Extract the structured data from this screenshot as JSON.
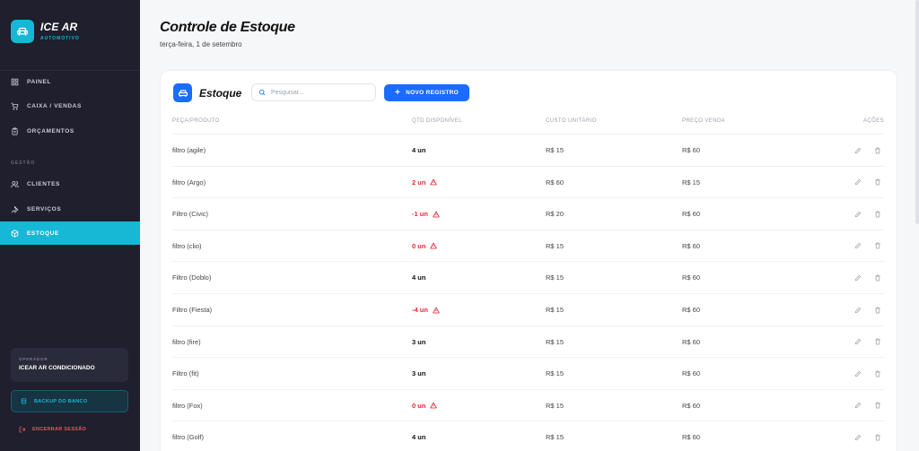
{
  "brand": {
    "name": "ICE AR",
    "subtitle": "AUTOMOTIVO"
  },
  "sidebar": {
    "items": [
      {
        "label": "PAINEL",
        "icon": "dashboard-icon"
      },
      {
        "label": "CAIXA / VENDAS",
        "icon": "cart-icon"
      },
      {
        "label": "ORÇAMENTOS",
        "icon": "clipboard-icon"
      }
    ],
    "section_label": "GESTÃO",
    "section_items": [
      {
        "label": "CLIENTES",
        "icon": "users-icon"
      },
      {
        "label": "SERVIÇOS",
        "icon": "wrench-icon"
      },
      {
        "label": "ESTOQUE",
        "icon": "box-icon",
        "active": true
      }
    ],
    "operator_label": "OPERADOR",
    "operator_name": "ICEAR AR CONDICIONADO",
    "backup_label": "BACKUP DO BANCO",
    "logout_label": "ENCERRAR SESSÃO"
  },
  "page": {
    "title": "Controle de Estoque",
    "date": "terça-feira, 1 de setembro"
  },
  "card": {
    "title": "Estoque",
    "search_placeholder": "Pesquisar...",
    "new_button": "NOVO REGISTRO",
    "columns": [
      "PEÇA/PRODUTO",
      "QTD DISPONÍVEL",
      "CUSTO UNITÁRIO",
      "PREÇO VENDA",
      "AÇÕES"
    ],
    "rows": [
      {
        "name": "filtro (agile)",
        "qty": "4 un",
        "low": false,
        "cost": "R$ 15",
        "price": "R$ 60"
      },
      {
        "name": "filtro (Argo)",
        "qty": "2 un",
        "low": true,
        "cost": "R$ 60",
        "price": "R$ 15"
      },
      {
        "name": "Filtro (Civic)",
        "qty": "-1 un",
        "low": true,
        "cost": "R$ 20",
        "price": "R$ 60"
      },
      {
        "name": "filtro (clio)",
        "qty": "0 un",
        "low": true,
        "cost": "R$ 15",
        "price": "R$ 60"
      },
      {
        "name": "Filtro (Doblo)",
        "qty": "4 un",
        "low": false,
        "cost": "R$ 15",
        "price": "R$ 60"
      },
      {
        "name": "Filtro (Fiesta)",
        "qty": "-4 un",
        "low": true,
        "cost": "R$ 15",
        "price": "R$ 60"
      },
      {
        "name": "filtro (fire)",
        "qty": "3 un",
        "low": false,
        "cost": "R$ 15",
        "price": "R$ 60"
      },
      {
        "name": "Filtro (fit)",
        "qty": "3 un",
        "low": false,
        "cost": "R$ 15",
        "price": "R$ 60"
      },
      {
        "name": "filtro (Fox)",
        "qty": "0 un",
        "low": true,
        "cost": "R$ 15",
        "price": "R$ 60"
      },
      {
        "name": "filtro (Golf)",
        "qty": "4 un",
        "low": false,
        "cost": "R$ 15",
        "price": "R$ 60"
      }
    ]
  },
  "colors": {
    "accent": "#16b8d6",
    "primary": "#1a6cff",
    "danger": "#e5262f",
    "sidebar_bg": "#1f1f2d"
  }
}
